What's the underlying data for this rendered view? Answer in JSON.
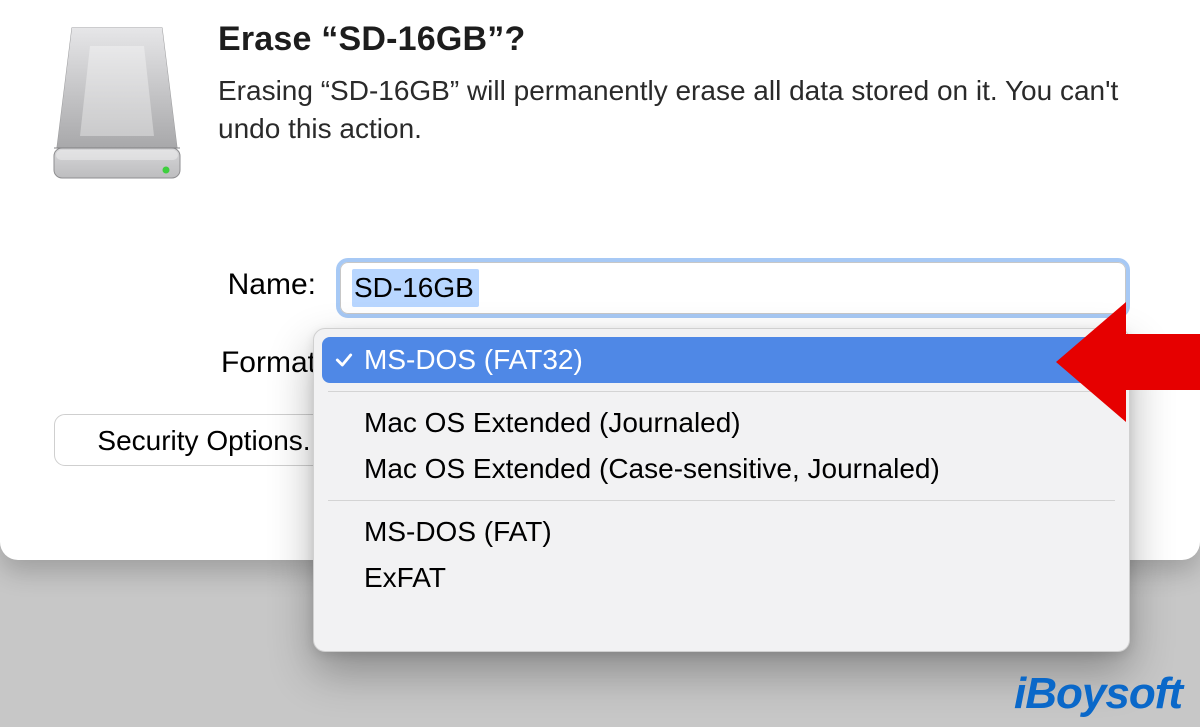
{
  "dialog": {
    "title": "Erase “SD-16GB”?",
    "description": "Erasing “SD-16GB” will permanently erase all data stored on it. You can't undo this action.",
    "name_label": "Name:",
    "name_value": "SD-16GB",
    "format_label": "Format",
    "security_button": "Security Options.",
    "icon_name": "external-disk"
  },
  "format_dropdown": {
    "selected_index": 0,
    "groups": [
      [
        "MS-DOS (FAT32)"
      ],
      [
        "Mac OS Extended (Journaled)",
        "Mac OS Extended (Case-sensitive, Journaled)"
      ],
      [
        "MS-DOS (FAT)",
        "ExFAT"
      ]
    ]
  },
  "annotation": {
    "arrow_color": "#E60000"
  },
  "watermark": {
    "text": "iBoysoft"
  }
}
